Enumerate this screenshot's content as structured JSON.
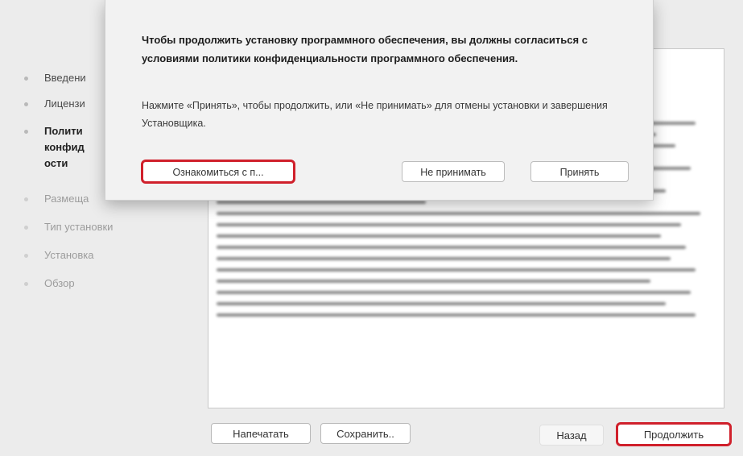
{
  "sidebar": {
    "steps": [
      {
        "label": "Введени",
        "state": "done"
      },
      {
        "label": "Лицензи",
        "state": "done"
      },
      {
        "label": "Полити",
        "state": "active"
      },
      {
        "label": "конфид",
        "state": "active"
      },
      {
        "label": "ости",
        "state": "active"
      },
      {
        "label": "Размеща",
        "state": "future"
      },
      {
        "label": "Тип установки",
        "state": "future"
      },
      {
        "label": "Установка",
        "state": "future"
      },
      {
        "label": "Обзор",
        "state": "future"
      }
    ]
  },
  "sheet": {
    "title": "Чтобы продолжить установку программного обеспечения, вы должны согласиться с условиями политики конфиденциальности программного обеспечения.",
    "body": "Нажмите «Принять», чтобы продолжить, или «Не принимать» для отмены установки и завершения Установщика.",
    "read_label": "Ознакомиться с п...",
    "decline_label": "Не принимать",
    "accept_label": "Принять"
  },
  "toolbar": {
    "print_label": "Напечатать",
    "save_label": "Сохранить..",
    "back_label": "Назад",
    "continue_label": "Продолжить"
  },
  "colors": {
    "highlight": "#d0202b",
    "window_bg": "#ececec"
  }
}
